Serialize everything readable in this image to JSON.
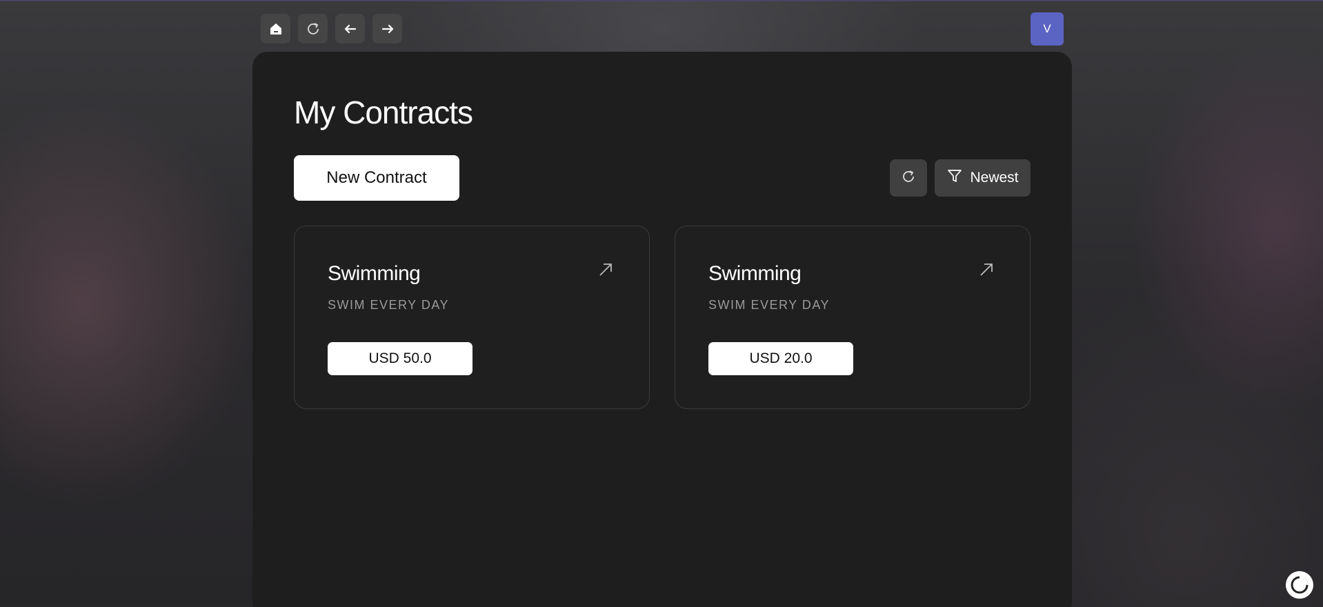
{
  "toolbar": {
    "buttons": [
      {
        "icon": "home-icon"
      },
      {
        "icon": "reload-icon"
      },
      {
        "icon": "arrow-left-icon"
      },
      {
        "icon": "arrow-right-icon"
      }
    ]
  },
  "user": {
    "avatar_initial": "V",
    "avatar_color": "#5b63c3"
  },
  "page": {
    "title": "My Contracts"
  },
  "actions": {
    "new_contract_label": "New Contract",
    "refresh_icon": "refresh-icon",
    "sort_icon": "filter-icon",
    "sort_label": "Newest"
  },
  "contracts": [
    {
      "title": "Swimming",
      "subtitle": "SWIM EVERY DAY",
      "amount": "USD 50.0",
      "icon": "arrow-up-right-icon"
    },
    {
      "title": "Swimming",
      "subtitle": "SWIM EVERY DAY",
      "amount": "USD 20.0",
      "icon": "arrow-up-right-icon"
    }
  ],
  "colors": {
    "panel": "#1e1e1e",
    "button_dark": "#404040",
    "accent_avatar": "#5b63c3",
    "subtitle_text": "#9a9a9a"
  }
}
